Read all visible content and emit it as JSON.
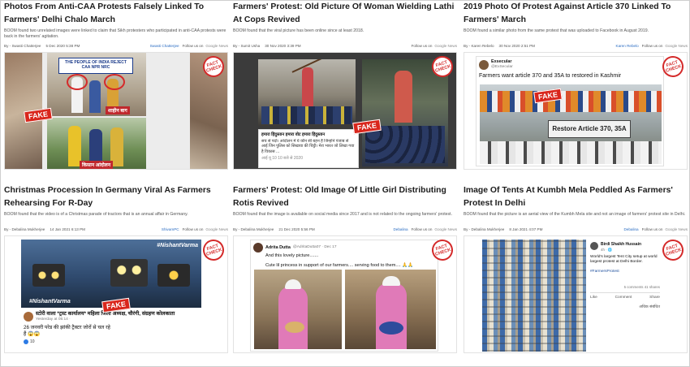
{
  "cards": [
    {
      "title": "Photos From Anti-CAA Protests Falsely Linked To Farmers' Delhi Chalo March",
      "summary": "BOOM found two unrelated images were linked to claim that Sikh protesters who participated in anti-CAA protests were back in the farmers' agitation.",
      "author": "By - Swasti Chatterjee",
      "date": "5 Dec 2020 5:38 PM",
      "source": "Swasti Chatterjee",
      "follow": "Follow us on",
      "gnews": "Google News",
      "stamp": [
        "FACT",
        "CHECK"
      ],
      "fake": "FAKE",
      "placard": "THE PEOPLE OF INDIA REJECT CAA NPR NRC",
      "caption1": "शाहीन बाग",
      "caption2": "किसान आंदोलन"
    },
    {
      "title": "Farmers' Protest: Old Picture Of Woman Wielding Lathi At Cops Revived",
      "summary": "BOOM found that the viral picture has been online since at least 2018.",
      "author": "By - Sumit Usha",
      "date": "30 Nov 2020 3:39 PM",
      "follow": "Follow us on",
      "gnews": "Google News",
      "stamp": [
        "FACT",
        "CHECK"
      ],
      "fake": "FAKE",
      "post_name": "हमारा हिंदुस्तान हमारा वोट हमारा हिंदुस्तान",
      "post_text": "सच से पर्दा। आंदोलन में ये कौन सी बहन हैं जिन्होंने पंजाब से आई जिन पुलिस को सिखाया की चिट्ठी। मेरा भारत जो लिखा गया है विकास ...",
      "post_meta": "आई यू 10 10 बजे से 2020"
    },
    {
      "title": "2019 Photo Of Protest Against Article 370 Linked To Farmers' March",
      "summary": "BOOM found a similar photo from the same protest that was uploaded to Facebook in August 2019.",
      "author": "By - Karen Rebelo",
      "date": "30 Nov 2020 2:51 PM",
      "source": "Karen Rebelo",
      "follow": "Follow us on",
      "gnews": "Google News",
      "stamp": [
        "FACT",
        "CHECK"
      ],
      "fake": "FAKE",
      "tw_name": "Exsecular",
      "tw_handle": "@ExSecular",
      "tweet": "Farmers want article 370 and 35A to restored in Kashmir",
      "banner": "Restore Article 370, 35A"
    },
    {
      "title": "Christmas Procession In Germany Viral As Farmers Rehearsing For R-Day",
      "summary": "BOOM found that the video is of a Christmas parade of tractors that is an annual affair in Germany.",
      "author": "By - Debalina Mukherjee",
      "date": "14 Jan 2021 6:13 PM",
      "source": "ShivamPC",
      "follow": "Follow us on",
      "gnews": "Google News",
      "stamp": [
        "FACT",
        "CHECK"
      ],
      "fake": "FAKE",
      "watermark": "#NishantVarma",
      "fb_name": "स्टोरी वाला *ट्रस्ट कार्यालय* महिला जिला अध्यक्ष, चौरंगी, संग्रहण कोलकाता",
      "fb_time": "Yesterday at 05:14 ·",
      "fb_text": "26 जनवरी परेड की झांकी ट्रैक्टर जोरों से चल रहे हैं 😱😱",
      "fb_count": "10"
    },
    {
      "title": "Farmers' Protest: Old Image Of Little Girl Distributing Rotis Revived",
      "summary": "BOOM found that the image is available on social media since 2017 and is not related to the ongoing farmers' protest.",
      "author": "By - Debalina Mukherjee",
      "date": "21 Dec 2020 5:56 PM",
      "source": "Debalina",
      "follow": "Follow us on",
      "gnews": "Google News",
      "stamp": [
        "FACT",
        "CHECK"
      ],
      "tw_name": "Adrita Dutta",
      "tw_handle": "@AdritaDutta07 · Dec 17",
      "tweet1": "And this lovely picture.......",
      "tweet2": "Cute lil princess in support of our farmers.... serving food to them.... 🙏🙏"
    },
    {
      "title": "Image Of Tents At Kumbh Mela Peddled As Farmers' Protest In Delhi",
      "summary": "BOOM found that the picture is an aerial view of the Kumbh Mela site and not an image of farmers' protest site in Delhi.",
      "author": "By - Debalina Mukherjee",
      "date": "8 Jan 2021 4:07 PM",
      "source": "Debalina",
      "follow": "Follow us on",
      "gnews": "Google News",
      "stamp": [
        "FACT",
        "CHECK"
      ],
      "fb_name": "Birdi Shaikh Hussain",
      "fb_time": "4h · 🌐",
      "fb_text": "World's largest Tent City setup at world largest protest at Delhi Border.",
      "fb_tag": "#FarmersProtest",
      "fb_stats": "5 comments 41 shares",
      "like": "Like",
      "comment": "Comment",
      "share": "Share",
      "more": "अधिक संबंधित"
    }
  ]
}
